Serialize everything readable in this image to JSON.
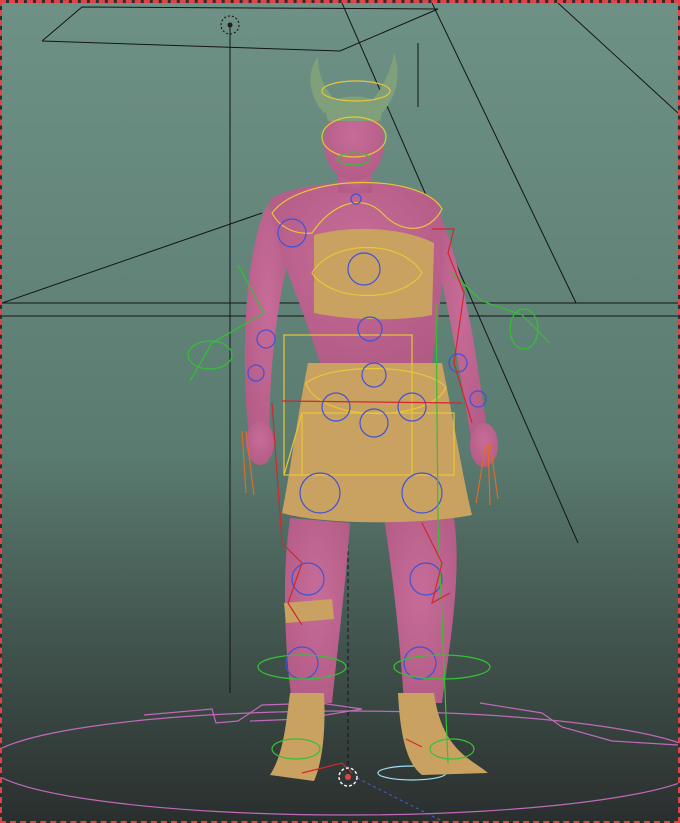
{
  "viewport": {
    "background_top": "#6e9186",
    "background_mid": "#5a7b70",
    "background_bottom": "#2a2f2e",
    "border_color": "#e0444a"
  },
  "character": {
    "skin_color": "#b05a84",
    "cloth_color": "#c9a262",
    "horn_color": "#7fa07a"
  },
  "rig": {
    "control_yellow": "#e8c636",
    "control_blue": "#3f52d8",
    "control_green": "#34c132",
    "control_red": "#d2282b",
    "control_orange": "#e06a2a",
    "ground_pink": "#c06ab8",
    "ground_cyan": "#9fe0ee",
    "helper_line": "#141414"
  },
  "icons": {
    "light": "dotted-circle-icon",
    "root": "origin-crosshair-icon"
  }
}
